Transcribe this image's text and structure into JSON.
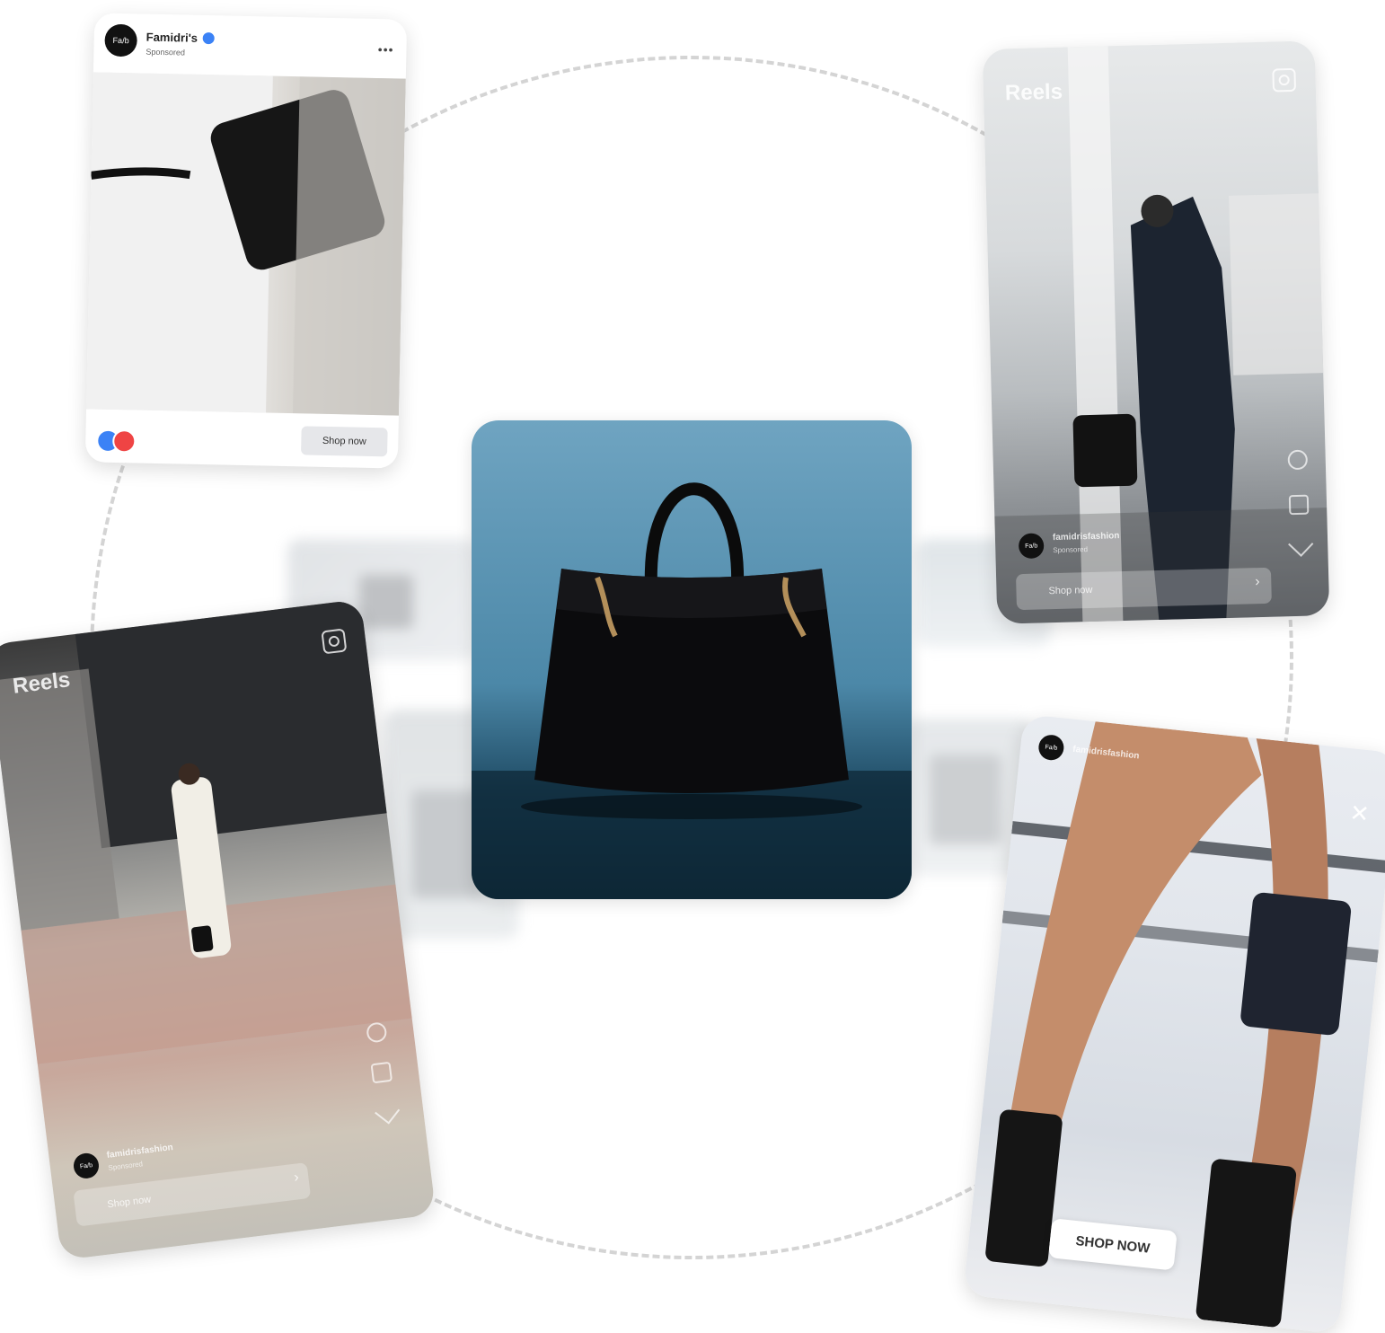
{
  "fb_post": {
    "brand_name": "Famidri's",
    "avatar_text": "Fa/b",
    "sponsored": "Sponsored",
    "more": "•••",
    "shop_label": "Shop now"
  },
  "reels_right": {
    "title": "Reels",
    "avatar_text": "Fa/b",
    "handle": "famidrisfashion",
    "sponsored": "Sponsored",
    "shop_label": "Shop now",
    "chevron": "›"
  },
  "reels_left": {
    "title": "Reels",
    "avatar_text": "Fa/b",
    "handle": "famidrisfashion",
    "sponsored": "Sponsored",
    "shop_label": "Shop now",
    "chevron": "›"
  },
  "story_right": {
    "avatar_text": "Fa/b",
    "handle": "famidrisfashion",
    "close": "✕",
    "shop_label": "SHOP NOW"
  },
  "colors": {
    "orbit": "#d4d4d4",
    "like": "#3b82f6",
    "love": "#ef4444",
    "product_bg": "#4c88a8"
  }
}
